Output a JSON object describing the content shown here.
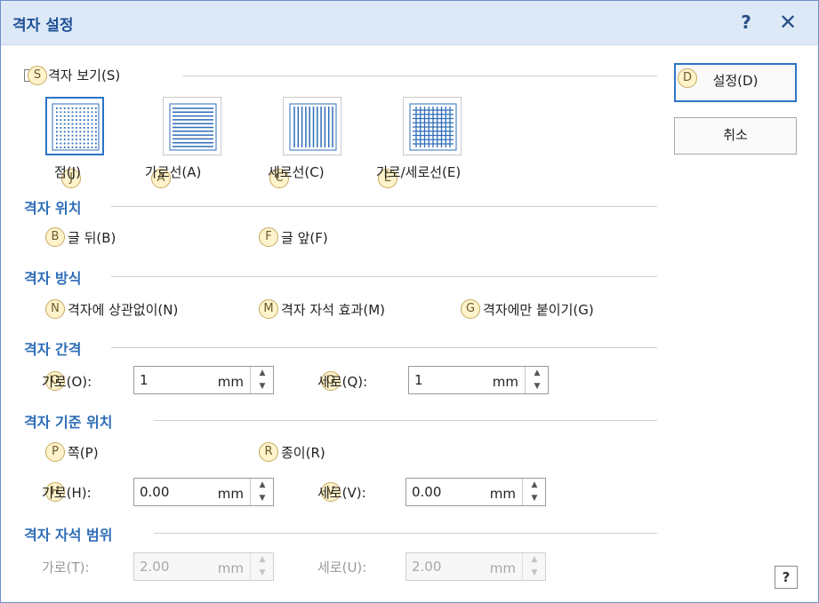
{
  "window": {
    "title": "격자 설정",
    "help_glyph": "?",
    "close_glyph": "✕"
  },
  "show_grid": {
    "label": "격자 보기(S)",
    "badge": "S",
    "checked": false
  },
  "grid_types": [
    {
      "label": "점(J)",
      "badge": "J",
      "icon": "dot-grid-icon",
      "selected": true
    },
    {
      "label": "가로선(A)",
      "badge": "A",
      "icon": "horizontal-lines-icon",
      "selected": false
    },
    {
      "label": "세로선(C)",
      "badge": "C",
      "icon": "vertical-lines-icon",
      "selected": false
    },
    {
      "label": "가로/세로선(E)",
      "badge": "E",
      "icon": "crosshatch-grid-icon",
      "selected": false
    }
  ],
  "position": {
    "title": "격자 위치",
    "options": [
      {
        "label": "글 뒤(B)",
        "badge": "B"
      },
      {
        "label": "글 앞(F)",
        "badge": "F"
      }
    ]
  },
  "method": {
    "title": "격자 방식",
    "options": [
      {
        "label": "격자에 상관없이(N)",
        "badge": "N"
      },
      {
        "label": "격자 자석 효과(M)",
        "badge": "M"
      },
      {
        "label": "격자에만 붙이기(G)",
        "badge": "G"
      }
    ]
  },
  "spacing": {
    "title": "격자 간격",
    "horizontal": {
      "label": "가로(O):",
      "badge": "O",
      "value": "1",
      "unit": "mm"
    },
    "vertical": {
      "label": "세로(Q):",
      "badge": "Q",
      "value": "1",
      "unit": "mm"
    }
  },
  "origin": {
    "title": "격자 기준 위치",
    "options": [
      {
        "label": "쪽(P)",
        "badge": "P"
      },
      {
        "label": "종이(R)",
        "badge": "R"
      }
    ],
    "horizontal": {
      "label": "가로(H):",
      "badge": "H",
      "value": "0.00",
      "unit": "mm"
    },
    "vertical": {
      "label": "세로(V):",
      "badge": "V",
      "value": "0.00",
      "unit": "mm"
    }
  },
  "magnet_range": {
    "title": "격자 자석 범위",
    "horizontal": {
      "label": "가로(T):",
      "value": "2.00",
      "unit": "mm"
    },
    "vertical": {
      "label": "세로(U):",
      "value": "2.00",
      "unit": "mm"
    }
  },
  "buttons": {
    "ok": {
      "label": "설정(D)",
      "badge": "D"
    },
    "cancel": {
      "label": "취소"
    },
    "help": {
      "label": "?"
    }
  },
  "colors": {
    "title_bg": "#dde9f7",
    "accent": "#2e6db8",
    "selection": "#2b73c8",
    "badge_bg": "#fff3cc"
  }
}
